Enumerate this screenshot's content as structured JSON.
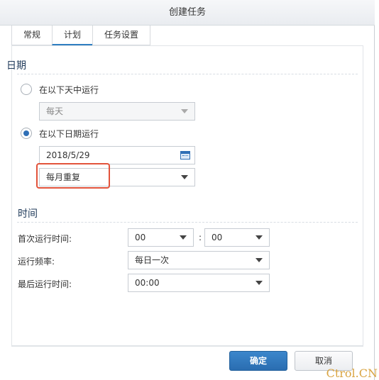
{
  "dialog": {
    "title": "创建任务"
  },
  "tabs": [
    {
      "label": "常规",
      "active": false
    },
    {
      "label": "计划",
      "active": true
    },
    {
      "label": "任务设置",
      "active": false
    }
  ],
  "date_section": {
    "title": "日期",
    "option_daily": {
      "label": "在以下天中运行",
      "checked": false,
      "select_value": "每天",
      "disabled": true
    },
    "option_date": {
      "label": "在以下日期运行",
      "checked": true,
      "date_value": "2018/5/29",
      "repeat_value": "每月重复"
    }
  },
  "time_section": {
    "title": "时间",
    "first_run": {
      "label": "首次运行时间:",
      "hour": "00",
      "separator": ":",
      "minute": "00"
    },
    "frequency": {
      "label": "运行频率:",
      "value": "每日一次"
    },
    "last_run": {
      "label": "最后运行时间:",
      "value": "00:00"
    }
  },
  "footer": {
    "ok_label": "确定",
    "cancel_label": "取消"
  },
  "watermark": "Ctrol.CN",
  "colors": {
    "accent": "#2f6fb6",
    "highlight": "#e2533b",
    "primary_button": "#2a6db0"
  }
}
